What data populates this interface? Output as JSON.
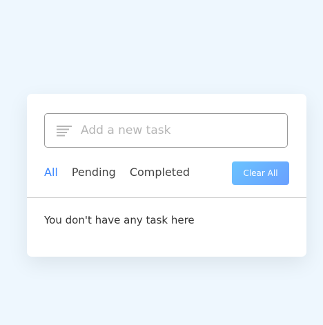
{
  "task_input": {
    "placeholder": "Add a new task",
    "value": "",
    "icon": "list-lines-icon"
  },
  "filters": {
    "all": "All",
    "pending": "Pending",
    "completed": "Completed",
    "active": "all"
  },
  "clear_button": {
    "label": "Clear All"
  },
  "task_list": {
    "empty_message": "You don't have any task here"
  },
  "colors": {
    "background": "#eef7fe",
    "active_filter": "#3c87ff",
    "button_gradient_start": "#6ac3ff",
    "button_gradient_end": "#6aa0ff"
  }
}
